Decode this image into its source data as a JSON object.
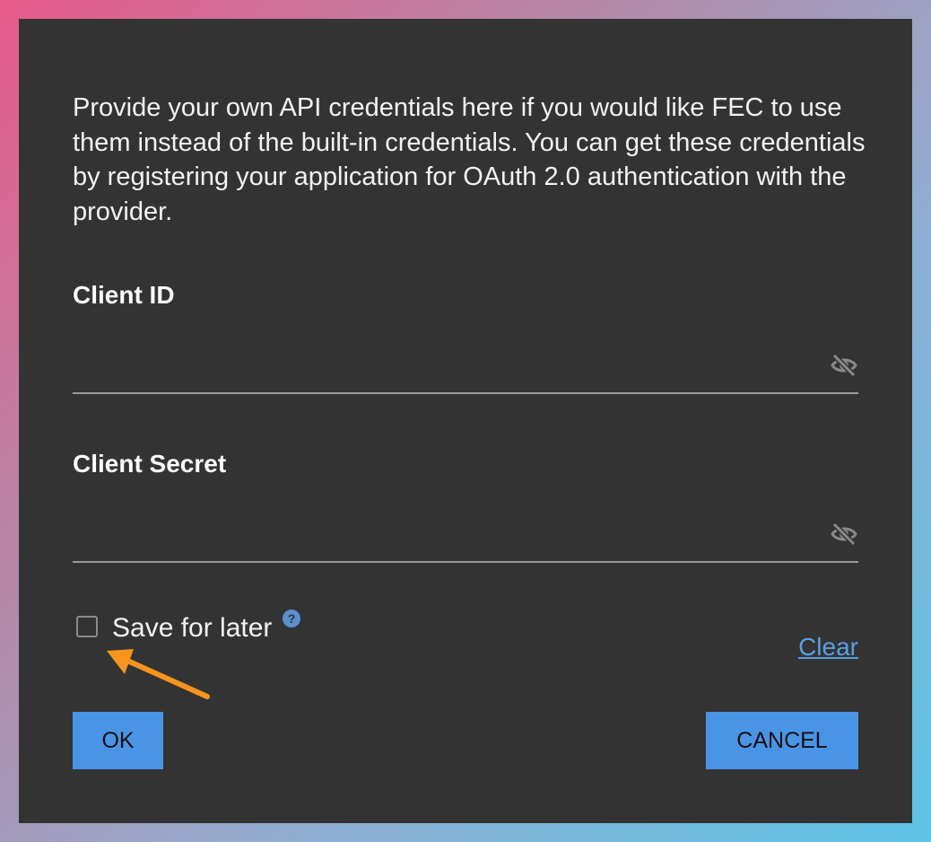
{
  "dialog": {
    "intro_text": "Provide your own API credentials here if you would like FEC to use them instead of the built-in credentials. You can get these credentials by registering your application for OAuth 2.0 authentication with the provider.",
    "client_id": {
      "label": "Client ID",
      "value": "",
      "placeholder": "",
      "icon": "eye-slash-icon"
    },
    "client_secret": {
      "label": "Client Secret",
      "value": "",
      "placeholder": "",
      "icon": "eye-slash-icon"
    },
    "save_for_later": {
      "label": "Save for later",
      "checked": false,
      "help_icon": "question-circle-icon",
      "help_glyph": "?"
    },
    "clear_link": "Clear",
    "ok_button": "OK",
    "cancel_button": "CANCEL"
  },
  "annotation": {
    "type": "arrow",
    "color": "#f7941d",
    "points_to": "save-for-later-checkbox"
  },
  "colors": {
    "dialog_bg": "#333333",
    "button_bg": "#4a94e6",
    "link": "#5b9fe2",
    "arrow": "#f7941d"
  }
}
